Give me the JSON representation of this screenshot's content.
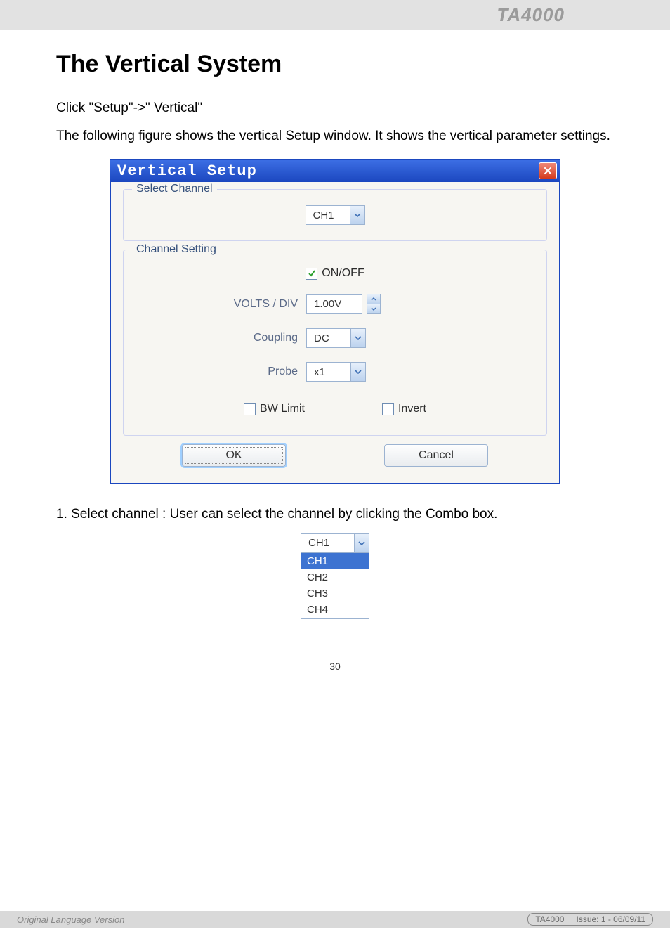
{
  "header": {
    "product": "TA4000"
  },
  "page": {
    "heading": "The Vertical System",
    "intro1": "Click \"Setup\"->\" Vertical\"",
    "intro2": "The following figure shows the vertical Setup window. It shows the vertical parameter settings.",
    "note1": "1. Select channel : User can select the channel by clicking the Combo box.",
    "number": "30"
  },
  "dialog": {
    "title": "Vertical Setup",
    "select_legend": "Select Channel",
    "channel_value": "CH1",
    "setting_legend": "Channel Setting",
    "onoff_label": "ON/OFF",
    "onoff_checked": true,
    "volts_label": "VOLTS / DIV",
    "volts_value": "1.00V",
    "coupling_label": "Coupling",
    "coupling_value": "DC",
    "probe_label": "Probe",
    "probe_value": "x1",
    "bwlimit_label": "BW Limit",
    "bwlimit_checked": false,
    "invert_label": "Invert",
    "invert_checked": false,
    "ok_label": "OK",
    "cancel_label": "Cancel"
  },
  "dropdown_demo": {
    "current": "CH1",
    "items": [
      "CH1",
      "CH2",
      "CH3",
      "CH4"
    ],
    "selected_index": 0
  },
  "footer": {
    "left": "Original Language Version",
    "product": "TA4000",
    "issue": "Issue: 1 - 06/09/11"
  }
}
